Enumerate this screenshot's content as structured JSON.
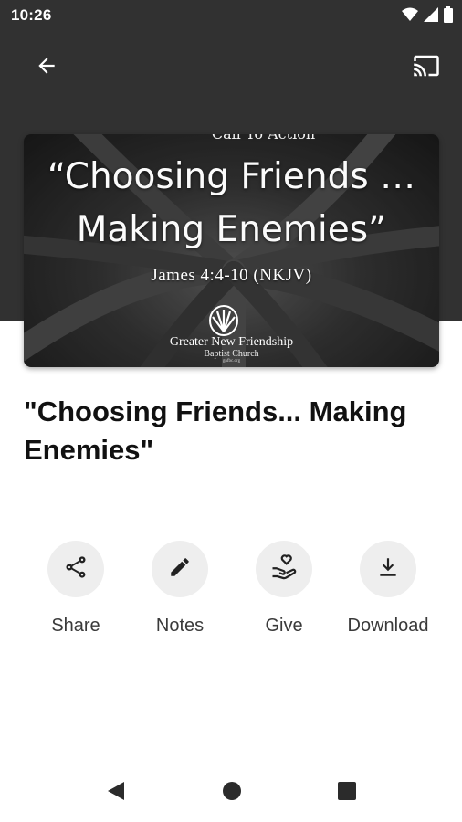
{
  "status_bar": {
    "time": "10:26",
    "icons": [
      "wifi-icon",
      "cellular-signal-icon",
      "battery-icon"
    ]
  },
  "toolbar": {
    "back_icon": "arrow-back-icon",
    "cast_icon": "cast-icon"
  },
  "artwork": {
    "top_text": "Call To Action",
    "title_line1": "“Choosing Friends …",
    "title_line2": "Making Enemies”",
    "verse": "James 4:4-10 (NKJV)",
    "church_name": "Greater New Friendship",
    "church_sub": "Baptist Church",
    "church_url": "gnfbc.org"
  },
  "sermon": {
    "title": "\"Choosing Friends... Making Enemies\""
  },
  "actions": [
    {
      "label": "Share",
      "icon": "share-icon"
    },
    {
      "label": "Notes",
      "icon": "pencil-icon"
    },
    {
      "label": "Give",
      "icon": "give-hand-heart-icon"
    },
    {
      "label": "Download",
      "icon": "download-icon"
    }
  ],
  "nav": {
    "back": "nav-back-icon",
    "home": "nav-home-icon",
    "recents": "nav-recents-icon"
  },
  "colors": {
    "header_bg": "#313131",
    "action_circle_bg": "#eeeeee",
    "title_text": "#111111"
  }
}
